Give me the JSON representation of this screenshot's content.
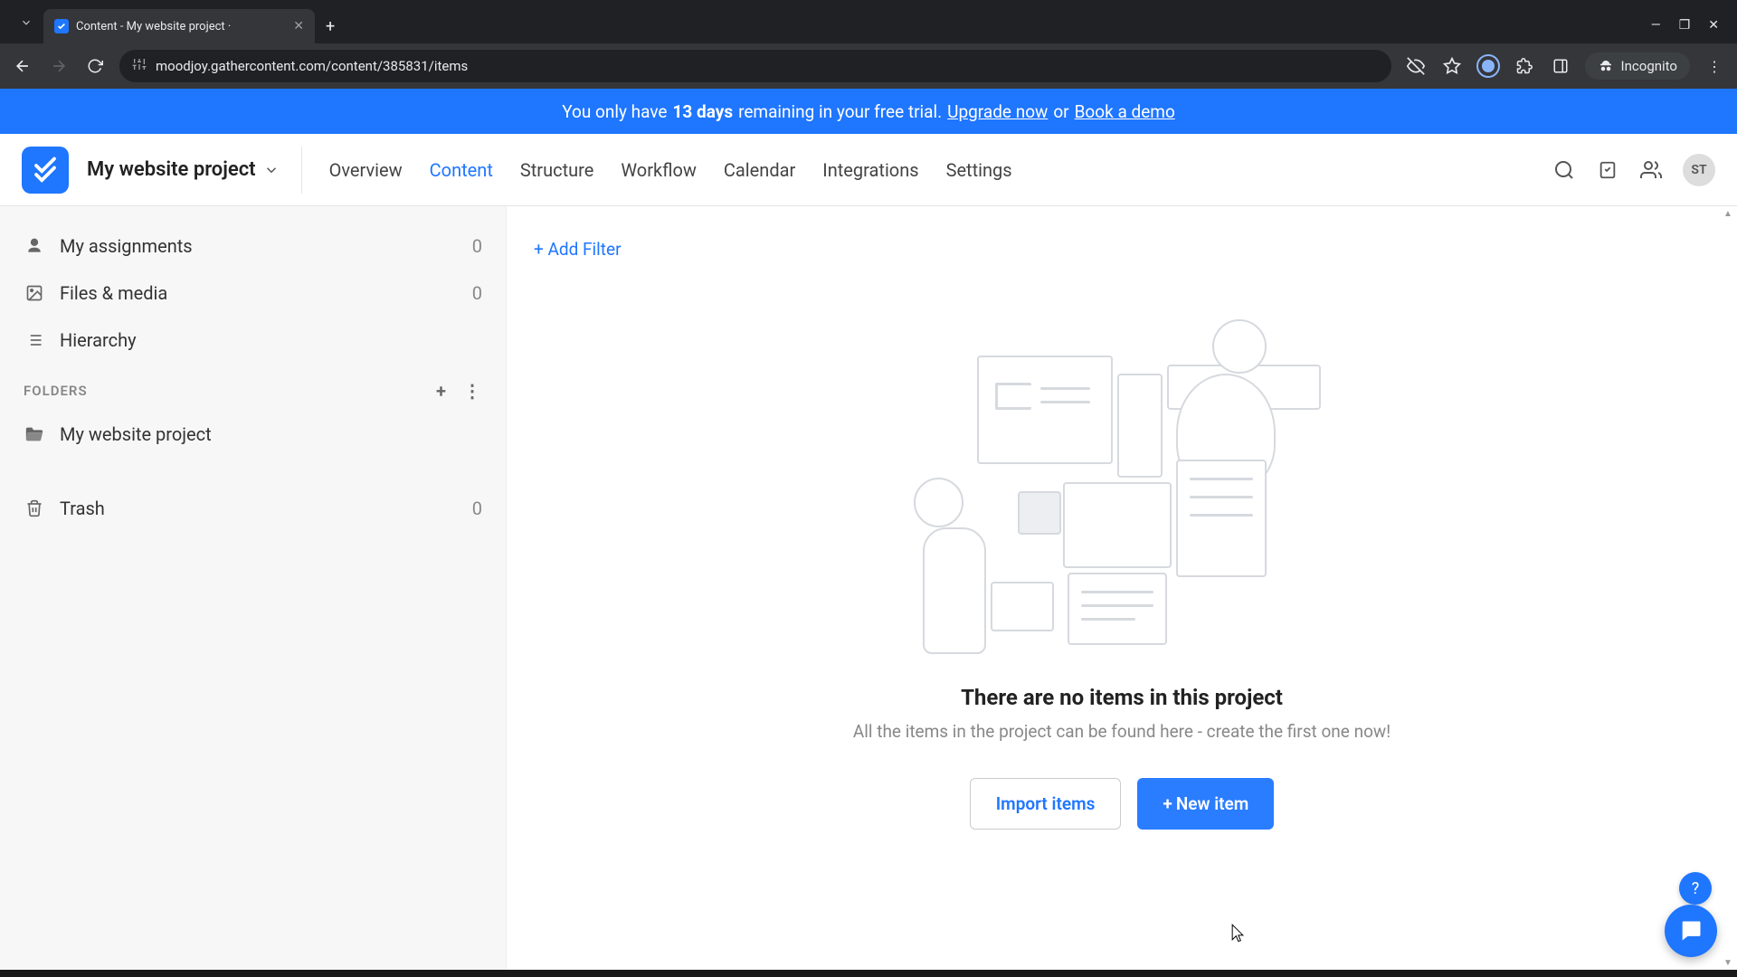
{
  "browser": {
    "tab_title": "Content - My website project ·",
    "url": "moodjoy.gathercontent.com/content/385831/items",
    "incognito_label": "Incognito"
  },
  "trial": {
    "prefix": "You only have ",
    "days": "13 days",
    "suffix": " remaining in your free trial. ",
    "upgrade": "Upgrade now",
    "or": " or ",
    "book": "Book a demo"
  },
  "header": {
    "project_name": "My website project",
    "nav": {
      "overview": "Overview",
      "content": "Content",
      "structure": "Structure",
      "workflow": "Workflow",
      "calendar": "Calendar",
      "integrations": "Integrations",
      "settings": "Settings"
    },
    "avatar_initials": "ST"
  },
  "sidebar": {
    "assignments": {
      "label": "My assignments",
      "count": "0"
    },
    "files": {
      "label": "Files & media",
      "count": "0"
    },
    "hierarchy": {
      "label": "Hierarchy"
    },
    "folders_label": "FOLDERS",
    "folder1": {
      "label": "My website project"
    },
    "trash": {
      "label": "Trash",
      "count": "0"
    }
  },
  "content": {
    "add_filter": "+ Add Filter",
    "empty_title": "There are no items in this project",
    "empty_sub": "All the items in the project can be found here - create the first one now!",
    "import_label": "Import items",
    "new_item_label": "New item"
  }
}
